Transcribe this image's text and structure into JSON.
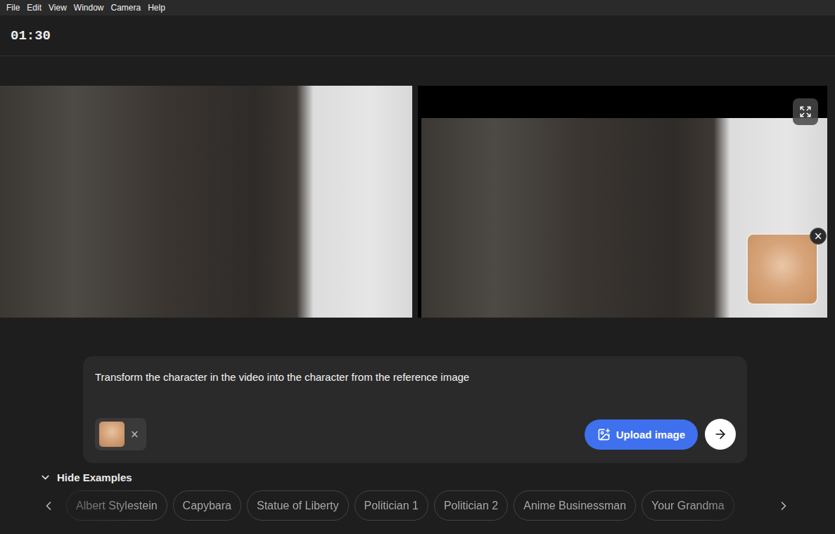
{
  "menu": [
    {
      "label": "File"
    },
    {
      "label": "Edit"
    },
    {
      "label": "View"
    },
    {
      "label": "Window"
    },
    {
      "label": "Camera"
    },
    {
      "label": "Help"
    }
  ],
  "timer": "01:30",
  "preview": {
    "reference_close": "×"
  },
  "prompt": {
    "text": "Transform the character in the video into the character from the reference image",
    "attachments": [
      {
        "remove": "×"
      }
    ],
    "upload_button": "Upload image"
  },
  "examples": {
    "toggle": "Hide Examples",
    "expanded": true,
    "items": [
      {
        "label": "Albert Stylestein"
      },
      {
        "label": "Capybara"
      },
      {
        "label": "Statue of Liberty"
      },
      {
        "label": "Politician 1"
      },
      {
        "label": "Politician 2"
      },
      {
        "label": "Anime Businessman"
      },
      {
        "label": "Your Grandma"
      }
    ]
  }
}
